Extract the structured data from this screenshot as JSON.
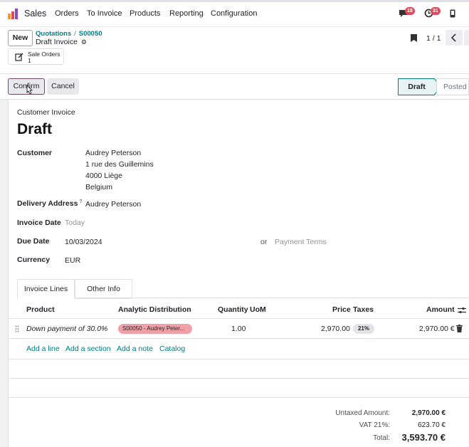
{
  "nav": {
    "app_name": "Sales",
    "menu": [
      "Orders",
      "To Invoice",
      "Products",
      "Reporting",
      "Configuration"
    ],
    "chat_badge": "18",
    "activity_badge": "31"
  },
  "control": {
    "new_label": "New",
    "breadcrumb_parent": "Quotations",
    "breadcrumb_current": "S00050",
    "breadcrumb_sep": "/",
    "record_title": "Draft Invoice",
    "smart_label": "Sale Orders",
    "smart_count": "1",
    "pager": "1 / 1"
  },
  "actions": {
    "confirm": "Confirm",
    "cancel": "Cancel",
    "status_draft": "Draft",
    "status_posted": "Posted"
  },
  "form": {
    "doc_kind": "Customer Invoice",
    "doc_name": "Draft",
    "customer_label": "Customer",
    "customer_lines": [
      "Audrey Peterson",
      "1 rue des Guillemins",
      "4000 Liège",
      "Belgium"
    ],
    "delivery_label": "Delivery Address",
    "delivery_help": "?",
    "delivery_value": "Audrey Peterson",
    "invoice_date_label": "Invoice Date",
    "invoice_date_placeholder": "Today",
    "due_date_label": "Due Date",
    "due_date_value": "10/03/2024",
    "or_label": "or",
    "payment_terms_placeholder": "Payment Terms",
    "currency_label": "Currency",
    "currency_value": "EUR"
  },
  "tabs": [
    "Invoice Lines",
    "Other Info"
  ],
  "lines": {
    "headers": [
      "Product",
      "Analytic Distribution",
      "Quantity",
      "UoM",
      "Price",
      "Taxes",
      "Amount"
    ],
    "rows": [
      {
        "product": "Down payment of 30.0%",
        "analytic": "S00050 - Audrey Peter...",
        "quantity": "1.00",
        "price": "2,970.00",
        "tax": "21%",
        "amount": "2,970.00 €"
      }
    ],
    "add_links": [
      "Add a line",
      "Add a section",
      "Add a note",
      "Catalog"
    ]
  },
  "totals": {
    "untaxed_label": "Untaxed Amount:",
    "untaxed_value": "2,970.00 €",
    "vat_label": "VAT 21%:",
    "vat_value": "623.70 €",
    "total_label": "Total:",
    "total_value": "3,593.70 €"
  },
  "colors": {
    "accent": "#017e84",
    "brand": "#714b67",
    "badge": "#e2495a",
    "tag_red": "#f0a1a8"
  }
}
